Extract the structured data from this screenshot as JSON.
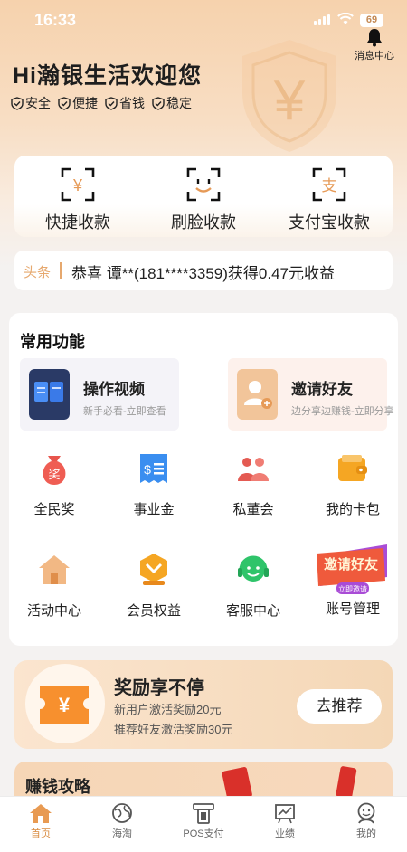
{
  "status_bar": {
    "time": "16:33",
    "battery": "69"
  },
  "header": {
    "message_center": "消息中心",
    "welcome": "Hi瀚银生活欢迎您",
    "tags": [
      "安全",
      "便捷",
      "省钱",
      "稳定"
    ]
  },
  "quick_pay": {
    "items": [
      {
        "label": "快捷收款",
        "icon": "yen-scan-icon"
      },
      {
        "label": "刷脸收款",
        "icon": "face-scan-icon"
      },
      {
        "label": "支付宝收款",
        "icon": "alipay-scan-icon"
      }
    ]
  },
  "news": {
    "tag": "头条",
    "text": "恭喜 谭**(181****3359)获得0.47元收益"
  },
  "functions": {
    "title": "常用功能",
    "features": [
      {
        "title": "操作视频",
        "subtitle": "新手必看-立即查看",
        "icon": "book-icon"
      },
      {
        "title": "邀请好友",
        "subtitle": "边分享边赚钱-立即分享",
        "icon": "add-user-icon"
      }
    ],
    "grid": [
      {
        "label": "全民奖",
        "icon": "reward-bag-icon"
      },
      {
        "label": "事业金",
        "icon": "dollar-receipt-icon"
      },
      {
        "label": "私董会",
        "icon": "people-icon"
      },
      {
        "label": "我的卡包",
        "icon": "wallet-icon"
      },
      {
        "label": "活动中心",
        "icon": "house-icon"
      },
      {
        "label": "会员权益",
        "icon": "medal-icon"
      },
      {
        "label": "客服中心",
        "icon": "headset-icon"
      },
      {
        "label": "账号管理",
        "icon": "invite-banner-icon"
      }
    ],
    "invite_banner": {
      "title": "邀请好友",
      "button": "立即邀请"
    }
  },
  "reward": {
    "title": "奖励享不停",
    "line1": "新用户激活奖励20元",
    "line2": "推荐好友激活奖励30元",
    "button": "去推荐"
  },
  "earn": {
    "title": "赚钱攻略"
  },
  "tabbar": {
    "items": [
      {
        "label": "首页",
        "icon": "home-icon",
        "active": true
      },
      {
        "label": "海淘",
        "icon": "globe-icon",
        "active": false
      },
      {
        "label": "POS支付",
        "icon": "pos-terminal-icon",
        "active": false
      },
      {
        "label": "业绩",
        "icon": "chart-board-icon",
        "active": false
      },
      {
        "label": "我的",
        "icon": "user-icon",
        "active": false
      }
    ]
  },
  "colors": {
    "accent": "#d98b3f",
    "news_tag": "#e6a86e",
    "hero_top": "#f6d2ad"
  }
}
